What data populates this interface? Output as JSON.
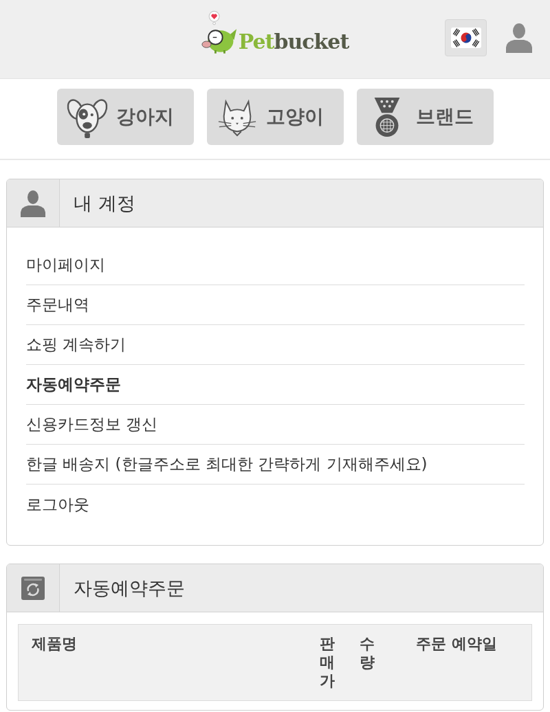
{
  "header": {
    "logo": {
      "primary": "Pet",
      "secondary": "bucket"
    }
  },
  "categories": [
    {
      "kind": "dog",
      "label": "강아지"
    },
    {
      "kind": "cat",
      "label": "고양이"
    },
    {
      "kind": "medal",
      "label": "브랜드"
    }
  ],
  "account_panel": {
    "title": "내 계정",
    "items": [
      {
        "label": "마이페이지",
        "selected": false
      },
      {
        "label": "주문내역",
        "selected": false
      },
      {
        "label": "쇼핑 계속하기",
        "selected": false
      },
      {
        "label": "자동예약주문",
        "selected": true
      },
      {
        "label": "신용카드정보 갱신",
        "selected": false
      },
      {
        "label": "한글 배송지 (한글주소로 최대한 간략하게 기재해주세요)",
        "selected": false
      },
      {
        "label": "로그아웃",
        "selected": false
      }
    ]
  },
  "auto_order_panel": {
    "title": "자동예약주문",
    "table": {
      "columns": [
        "제품명",
        "판매가",
        "수량",
        "주문 예약일"
      ]
    }
  }
}
